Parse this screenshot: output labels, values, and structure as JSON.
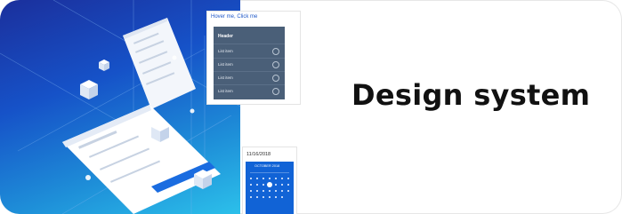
{
  "banner": {
    "title": "Design system"
  },
  "dropdown_preview": {
    "trigger_label": "Hover me, Click me",
    "menu_header": "Header",
    "items": [
      "List item",
      "List item",
      "List item",
      "List item"
    ]
  },
  "calendar_preview": {
    "date_value": "11/16/2018",
    "month_label": "OCTOBER 2018"
  },
  "colors": {
    "hero_dark": "#1b2f9c",
    "hero_light": "#2cc0ea",
    "menu_bg": "#4a5f78",
    "calendar_bg": "#1163d6"
  }
}
